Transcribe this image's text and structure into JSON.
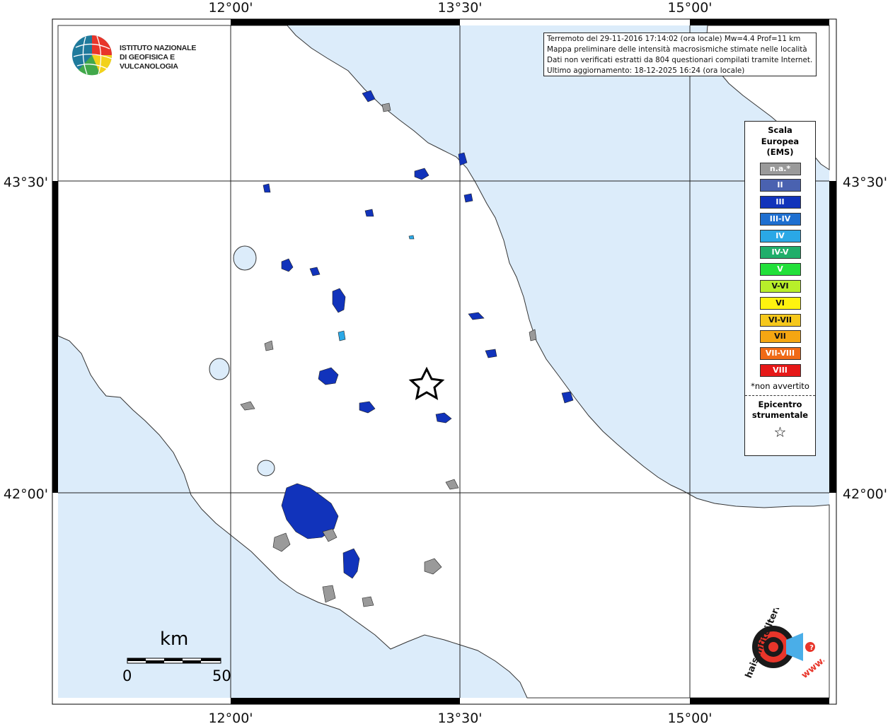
{
  "map": {
    "lon_labels": [
      "12°00'",
      "13°30'",
      "15°00'"
    ],
    "lat_labels": [
      "43°30'",
      "42°00'"
    ],
    "colors": {
      "sea": "#dcecfa",
      "land": "#ffffff",
      "frame": "#000000",
      "grid": "#222222"
    }
  },
  "info": {
    "line1": "Terremoto del 29-11-2016 17:14:02 (ora locale) Mw=4.4 Prof=11 km",
    "line2": "Mappa preliminare delle intensità macrosismiche stimate nelle località",
    "line3": "Dati non verificati estratti da 804 questionari compilati tramite Internet.",
    "line4": "Ultimo aggiornamento: 18-12-2025 16:24 (ora locale)"
  },
  "legend": {
    "title_lines": [
      "Scala",
      "Europea",
      "(EMS)"
    ],
    "items": [
      {
        "label": "n.a.*",
        "color": "#9a9a9a"
      },
      {
        "label": "II",
        "color": "#4a62b0"
      },
      {
        "label": "III",
        "color": "#1133bb"
      },
      {
        "label": "III-IV",
        "color": "#1e6fd0"
      },
      {
        "label": "IV",
        "color": "#2aa8e6"
      },
      {
        "label": "IV-V",
        "color": "#1fae6a"
      },
      {
        "label": "V",
        "color": "#22e03a"
      },
      {
        "label": "V-VI",
        "color": "#b8ef2a"
      },
      {
        "label": "VI",
        "color": "#fff30f"
      },
      {
        "label": "VI-VII",
        "color": "#f6c81c"
      },
      {
        "label": "VII",
        "color": "#f5a612"
      },
      {
        "label": "VII-VIII",
        "color": "#f06a16"
      },
      {
        "label": "VIII",
        "color": "#e61818"
      }
    ],
    "note": "*non avvertito",
    "epicenter_lines": [
      "Epicentro",
      "strumentale"
    ],
    "epicenter_symbol": "☆"
  },
  "logo": {
    "ingv_line1": "ISTITUTO NAZIONALE",
    "ingv_line2": "DI GEOFISICA E VULCANOLOGIA",
    "hsit_text": "haisentitoilterremoto.it",
    "hsit_www": "www."
  },
  "scale": {
    "unit": "km",
    "start": "0",
    "end": "50"
  },
  "epicenter": {
    "symbol": "star-icon"
  }
}
